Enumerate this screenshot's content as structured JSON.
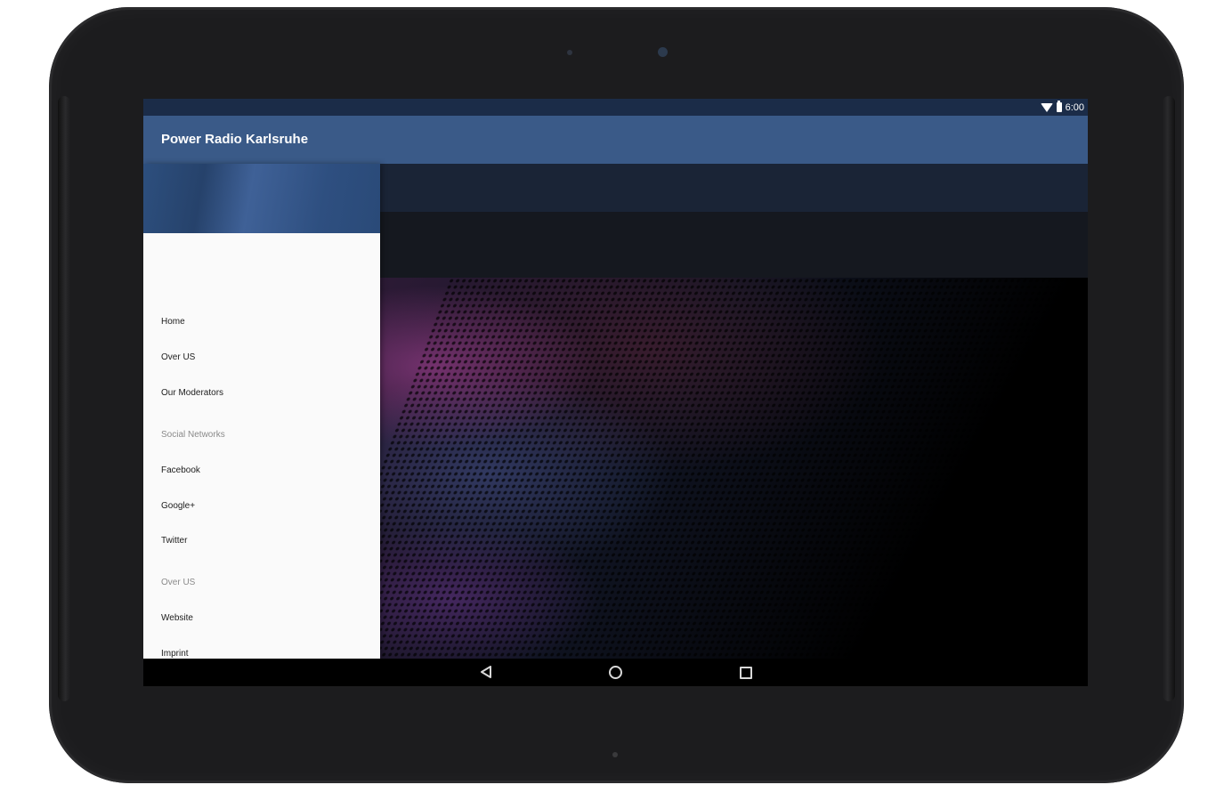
{
  "status_bar": {
    "time": "6:00",
    "icons": [
      "wifi-icon",
      "battery-icon"
    ]
  },
  "app_bar": {
    "title": "Power Radio Karlsruhe"
  },
  "drawer": {
    "items": [
      {
        "label": "Home",
        "type": "item"
      },
      {
        "label": "Over US",
        "type": "item"
      },
      {
        "label": "Our Moderators",
        "type": "item"
      },
      {
        "label": "Social Networks",
        "type": "header"
      },
      {
        "label": "Facebook",
        "type": "item"
      },
      {
        "label": "Google+",
        "type": "item"
      },
      {
        "label": "Twitter",
        "type": "item"
      },
      {
        "label": "Over US",
        "type": "header"
      },
      {
        "label": "Website",
        "type": "item"
      },
      {
        "label": "Imprint",
        "type": "item"
      }
    ]
  },
  "nav_bar": {
    "icons": [
      "back-icon",
      "home-icon",
      "recents-icon"
    ]
  },
  "colors": {
    "status_bar": "#1b2c48",
    "app_bar": "#3a5a88",
    "drawer_bg": "#fafafa",
    "content_band": "#1a2436"
  }
}
